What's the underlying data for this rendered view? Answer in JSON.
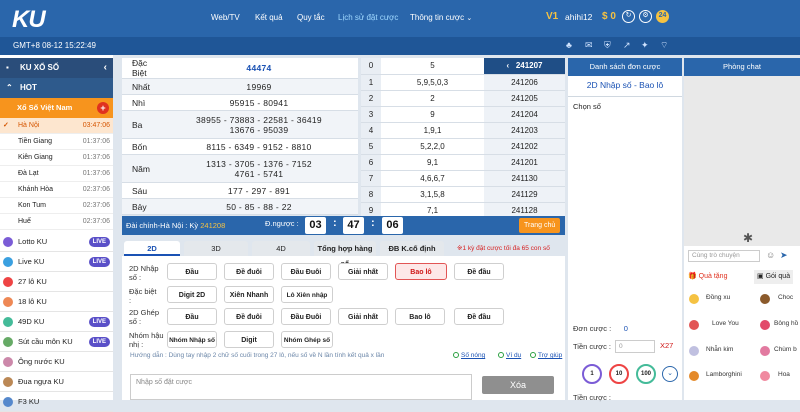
{
  "header": {
    "logo": "KU",
    "nav": [
      {
        "label": "Web/TV"
      },
      {
        "label": "Kết quả"
      },
      {
        "label": "Quy tắc"
      },
      {
        "label": "Lịch sử đặt cược"
      },
      {
        "label": "Thông tin cược"
      }
    ],
    "vip": "V1",
    "username": "ahihi12",
    "balance": "$ 0",
    "badge": "24"
  },
  "subbar": {
    "time": "GMT+8 08-12 15:22:49"
  },
  "sidebar": {
    "title": "KU XỔ SỐ",
    "hot": "HOT",
    "group": "Xổ Số Việt Nam",
    "cities": [
      {
        "name": "Hà Nội",
        "time": "03:47:06"
      },
      {
        "name": "Tiền Giang",
        "time": "01:37:06"
      },
      {
        "name": "Kiên Giang",
        "time": "01:37:06"
      },
      {
        "name": "Đà Lạt",
        "time": "01:37:06"
      },
      {
        "name": "Khánh Hòa",
        "time": "02:37:06"
      },
      {
        "name": "Kon Tum",
        "time": "02:37:06"
      },
      {
        "name": "Huế",
        "time": "02:37:06"
      }
    ],
    "games": [
      {
        "name": "Lotto KU",
        "live": "LIVE"
      },
      {
        "name": "Live KU",
        "live": "LIVE"
      },
      {
        "name": "27 lô KU",
        "live": ""
      },
      {
        "name": "18 lô KU",
        "live": ""
      },
      {
        "name": "49D KU",
        "live": "LIVE"
      },
      {
        "name": "Sút cầu môn KU",
        "live": "LIVE"
      },
      {
        "name": "Ông nước KU",
        "live": ""
      },
      {
        "name": "Đua ngựa KU",
        "live": ""
      },
      {
        "name": "F3 KU",
        "live": ""
      }
    ]
  },
  "results": {
    "rows": [
      {
        "label": "Đặc Biệt",
        "line1": "44474"
      },
      {
        "label": "Nhất",
        "line1": "19969"
      },
      {
        "label": "Nhì",
        "line1": "95915 - 80941"
      },
      {
        "label": "Ba",
        "line1": "38955 - 73883 - 22581 - 36419",
        "line2": "13676 - 95039"
      },
      {
        "label": "Bốn",
        "line1": "8115 - 6349 - 9152 - 8810"
      },
      {
        "label": "Năm",
        "line1": "1313 - 3705 - 1376 - 7152",
        "line2": "4761 - 5741"
      },
      {
        "label": "Sáu",
        "line1": "177 - 297 - 891"
      },
      {
        "label": "Bảy",
        "line1": "50 - 85 - 88 - 22"
      }
    ]
  },
  "stats": {
    "header_period": "241207",
    "rows": [
      {
        "d": "0",
        "v": "5",
        "p": ""
      },
      {
        "d": "1",
        "v": "5,9,5,0,3",
        "p": "241206"
      },
      {
        "d": "2",
        "v": "2",
        "p": "241205"
      },
      {
        "d": "3",
        "v": "9",
        "p": "241204"
      },
      {
        "d": "4",
        "v": "1,9,1",
        "p": "241203"
      },
      {
        "d": "5",
        "v": "5,2,2,0",
        "p": "241202"
      },
      {
        "d": "6",
        "v": "9,1",
        "p": "241201"
      },
      {
        "d": "7",
        "v": "4,6,6,7",
        "p": "241130"
      },
      {
        "d": "8",
        "v": "3,1,5,8",
        "p": "241129"
      },
      {
        "d": "9",
        "v": "7,1",
        "p": "241128"
      }
    ]
  },
  "countdown": {
    "station": "Đài chính-Hà Nội",
    "ky_label": "Kỳ",
    "ky": "241208",
    "label": "Đ.ngược :",
    "h": "03",
    "m": "47",
    "s": "06",
    "home": "Trang chủ"
  },
  "bet": {
    "tabs": [
      "2D",
      "3D",
      "4D",
      "Tổng hợp hàng số",
      "ĐB K.cố định"
    ],
    "note": "※1 kỳ đặt cược tối đa 65 con số",
    "rows": [
      {
        "label": "2D Nhập số :",
        "buttons": [
          "Đầu",
          "Đề đuôi",
          "Đầu Đuôi",
          "Giải nhất",
          "Bao lô",
          "Đề đầu"
        ]
      },
      {
        "label": "Đặc biệt :",
        "buttons": [
          "Digit 2D",
          "Xiên Nhanh",
          "Lô Xiên nhập số"
        ]
      },
      {
        "label": "2D Ghép số :",
        "buttons": [
          "Đầu",
          "Đề đuôi",
          "Đầu Đuôi",
          "Giải nhất",
          "Bao lô",
          "Đề đầu"
        ]
      },
      {
        "label": "Nhóm hậu nhị :",
        "buttons": [
          "Nhóm Nhập số",
          "Digit",
          "Nhóm Ghép số"
        ]
      }
    ],
    "guide": "Hướng dẫn : Dùng tay nhập 2 chữ số cuối trong 27 lô, nếu số về N lần tính kết quả x lần",
    "options": [
      "Số nóng",
      "Ví dụ",
      "Trợ giúp"
    ],
    "placeholder": "Nhập số đặt cược",
    "delete": "Xóa"
  },
  "order": {
    "title": "Danh sách đơn cược",
    "type": "2D Nhập số - Bao lô",
    "choose": "Chọn số",
    "don_label": "Đơn cược :",
    "don_value": "0",
    "tien_label": "Tiền cược :",
    "tien_placeholder": "0",
    "multiplier": "X27",
    "chips": [
      "1",
      "10",
      "100"
    ],
    "tien_cuoc2": "Tiền cược :"
  },
  "chat": {
    "title": "Phòng chat",
    "placeholder": "Cùng trò chuyện",
    "tabs": [
      "Quà tặng",
      "Gói quà"
    ],
    "gifts": [
      "Đồng xu",
      "Love You",
      "Nhẫn kim",
      "Lamborghini"
    ],
    "gifts2": [
      "Choc",
      "Bông hồ",
      "Chùm b",
      "Hoa"
    ]
  },
  "colors": {
    "primary": "#2a66ab",
    "accent": "#f7941d",
    "selected": "#d01818"
  }
}
